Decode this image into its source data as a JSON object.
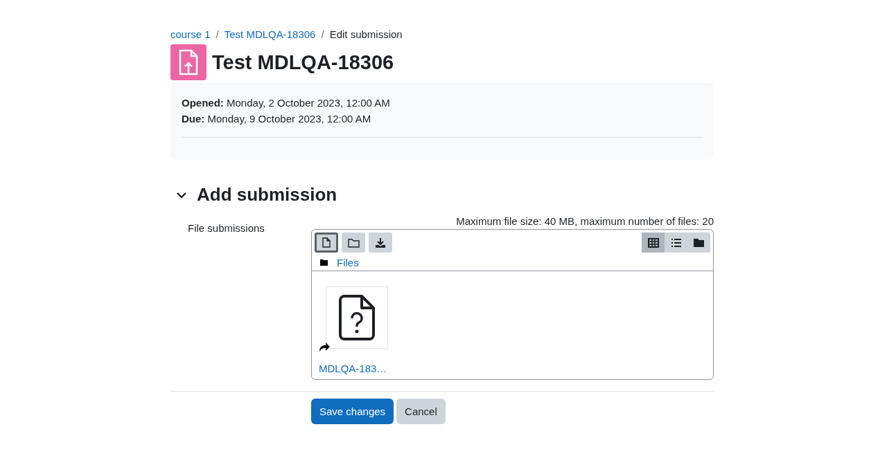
{
  "breadcrumb": [
    {
      "label": "course 1",
      "kind": "link"
    },
    {
      "label": "/",
      "kind": "separator"
    },
    {
      "label": "Test MDLQA-18306",
      "kind": "link"
    },
    {
      "label": "/",
      "kind": "separator"
    },
    {
      "label": "Edit submission",
      "kind": "current"
    }
  ],
  "title": "Test MDLQA-18306",
  "dates": [
    {
      "label": "Opened:",
      "value": "Monday, 2 October 2023, 12:00 AM"
    },
    {
      "label": "Due:",
      "value": "Monday, 9 October 2023, 12:00 AM"
    }
  ],
  "section": {
    "title": "Add submission",
    "expanded": true
  },
  "field": {
    "label": "File submissions",
    "limits": "Maximum file size: 40 MB, maximum number of files: 20"
  },
  "toolbar": [
    {
      "kind": "add-file",
      "focused": true
    },
    {
      "kind": "new-folder",
      "focused": false
    },
    {
      "kind": "download",
      "focused": false
    }
  ],
  "views": [
    {
      "kind": "grid",
      "selected": true
    },
    {
      "kind": "list",
      "selected": false
    },
    {
      "kind": "tree",
      "selected": false
    }
  ],
  "path": "Files",
  "files": [
    {
      "name": "MDLQA-183…",
      "alias": true
    }
  ],
  "buttons": [
    {
      "label": "Save changes",
      "kind": "primary"
    },
    {
      "label": "Cancel",
      "kind": "secondary"
    }
  ]
}
